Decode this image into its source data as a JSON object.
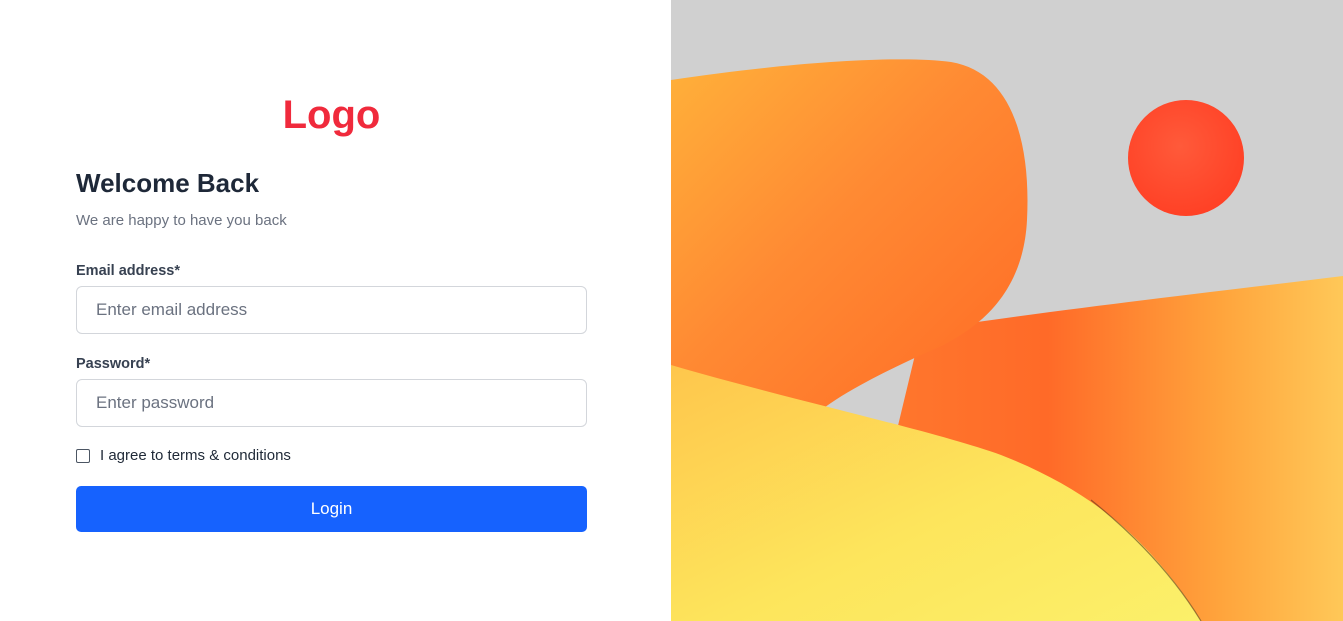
{
  "brand": {
    "logo_text": "Logo",
    "logo_color": "#f02a3c"
  },
  "form": {
    "title": "Welcome Back",
    "subtitle": "We are happy to have you back",
    "email": {
      "label": "Email address*",
      "placeholder": "Enter email address",
      "value": ""
    },
    "password": {
      "label": "Password*",
      "placeholder": "Enter password",
      "value": ""
    },
    "terms": {
      "label": "I agree to terms & conditions",
      "checked": false
    },
    "submit_label": "Login",
    "accent_color": "#1662fe"
  },
  "illustration": {
    "icon": "abstract-3d-landscape-illustration",
    "colors": {
      "sky": "#d0d0d0",
      "sun": "#ff4a2e",
      "orange": "#ff7a2e",
      "yellow": "#fce25a"
    }
  }
}
